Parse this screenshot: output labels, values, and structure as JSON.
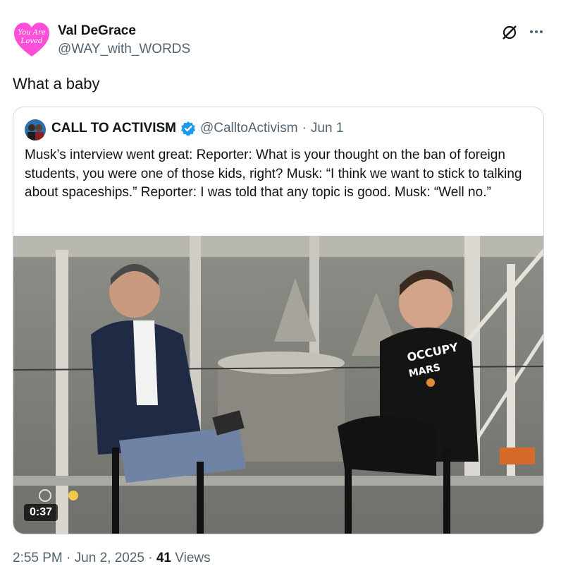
{
  "author": {
    "name": "Val DeGrace",
    "handle": "@WAY_with_WORDS",
    "avatar_text": [
      "You Are",
      "Loved"
    ],
    "avatar_color": "#ff4fd8"
  },
  "tweet": {
    "text": "What a baby"
  },
  "quoted": {
    "name": "CALL TO ACTIVISM",
    "handle": "@CalltoActivism",
    "separator": "·",
    "date": "Jun 1",
    "verified_color": "#1d9bf0",
    "text": "Musk’s interview went great: Reporter: What is your thought on the ban of foreign students, you were one of those kids, right? Musk: “I think we want to stick to talking about spaceships.” Reporter: I was told that any topic is good. Musk: “Well no.”",
    "video": {
      "duration": "0:37",
      "shirt_text": [
        "OCCUPY",
        "MARS"
      ]
    }
  },
  "meta": {
    "time": "2:55 PM",
    "separator1": "·",
    "date": "Jun 2, 2025",
    "separator2": "·",
    "views_count": "41",
    "views_label": "Views"
  },
  "icons": {
    "grok": "grok-icon",
    "more": "more-icon",
    "verified": "verified-badge-icon"
  }
}
